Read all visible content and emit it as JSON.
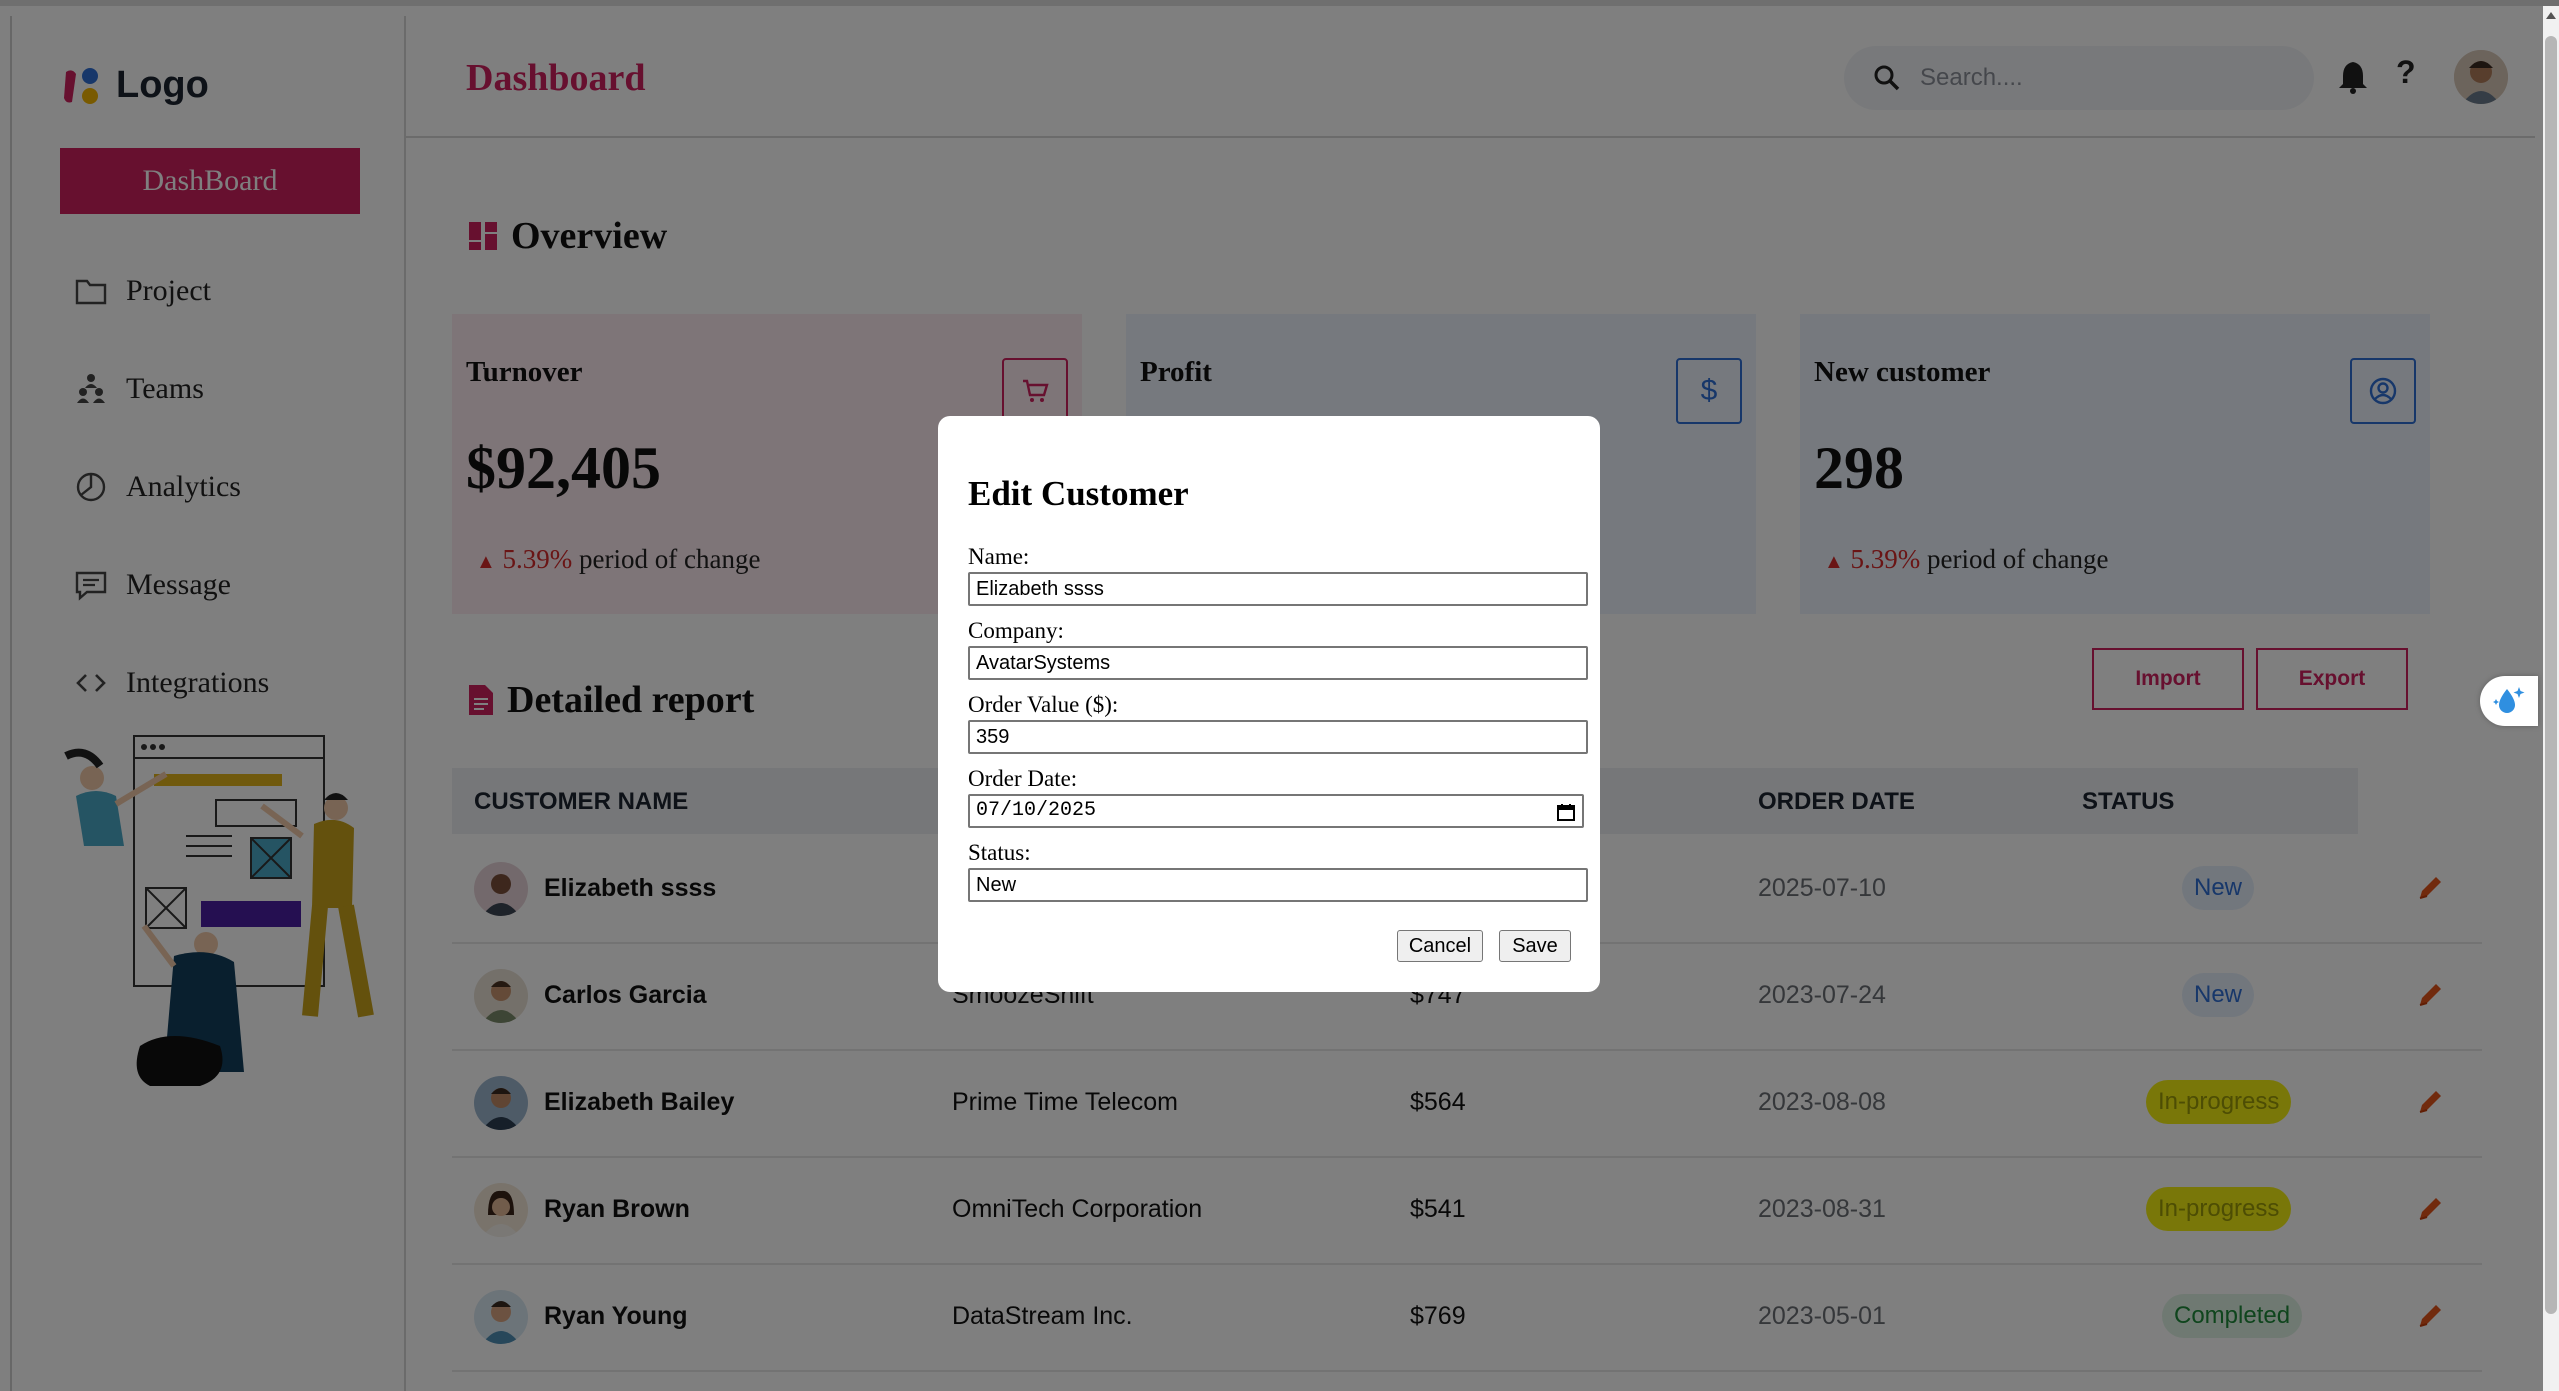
{
  "app": {
    "logo_text": "Logo",
    "page_title": "Dashboard",
    "search_placeholder": "Search....",
    "help_label": "?"
  },
  "sidebar": {
    "active": "DashBoard",
    "items": [
      {
        "label": "Project",
        "icon": "folder-icon"
      },
      {
        "label": "Teams",
        "icon": "teams-icon"
      },
      {
        "label": "Analytics",
        "icon": "pie-chart-icon"
      },
      {
        "label": "Message",
        "icon": "message-icon"
      },
      {
        "label": "Integrations",
        "icon": "code-icon"
      }
    ]
  },
  "overview": {
    "title": "Overview",
    "cards": [
      {
        "label": "Turnover",
        "value": "$92,405",
        "change_pct": "5.39%",
        "change_text": "period of change",
        "icon": "cart-icon",
        "color": "#cf215f",
        "bg": "#fdeaf1"
      },
      {
        "label": "Profit",
        "value": "",
        "change_pct": "",
        "change_text": "",
        "icon": "dollar-icon",
        "color": "#2f6fd4",
        "bg": "#ecf3fd"
      },
      {
        "label": "New customer",
        "value": "298",
        "change_pct": "5.39%",
        "change_text": "period of change",
        "icon": "user-circle-icon",
        "color": "#2f6fd4",
        "bg": "#ecf3fd"
      }
    ]
  },
  "report": {
    "title": "Detailed report",
    "import_label": "Import",
    "export_label": "Export",
    "columns": {
      "customer": "CUSTOMER NAME",
      "date": "ORDER DATE",
      "status": "STATUS"
    },
    "rows": [
      {
        "name": "Elizabeth ssss",
        "company": "",
        "value": "",
        "date": "2025-07-10",
        "status": "New"
      },
      {
        "name": "Carlos Garcia",
        "company": "SmoozeShift",
        "value": "$747",
        "date": "2023-07-24",
        "status": "New"
      },
      {
        "name": "Elizabeth Bailey",
        "company": "Prime Time Telecom",
        "value": "$564",
        "date": "2023-08-08",
        "status": "In-progress"
      },
      {
        "name": "Ryan Brown",
        "company": "OmniTech Corporation",
        "value": "$541",
        "date": "2023-08-31",
        "status": "In-progress"
      },
      {
        "name": "Ryan Young",
        "company": "DataStream Inc.",
        "value": "$769",
        "date": "2023-05-01",
        "status": "Completed"
      }
    ]
  },
  "modal": {
    "title": "Edit Customer",
    "name_label": "Name:",
    "name_value": "Elizabeth ssss",
    "company_label": "Company:",
    "company_value": "AvatarSystems",
    "order_value_label": "Order Value ($):",
    "order_value": "359",
    "order_date_label": "Order Date:",
    "order_date_value": "07/10/2025",
    "status_label": "Status:",
    "status_value": "New",
    "cancel_label": "Cancel",
    "save_label": "Save"
  },
  "colors": {
    "accent": "#cf215f",
    "status_new": "#2f6fd4",
    "status_progress": "#a9a20a",
    "status_completed": "#1e8a3a"
  }
}
